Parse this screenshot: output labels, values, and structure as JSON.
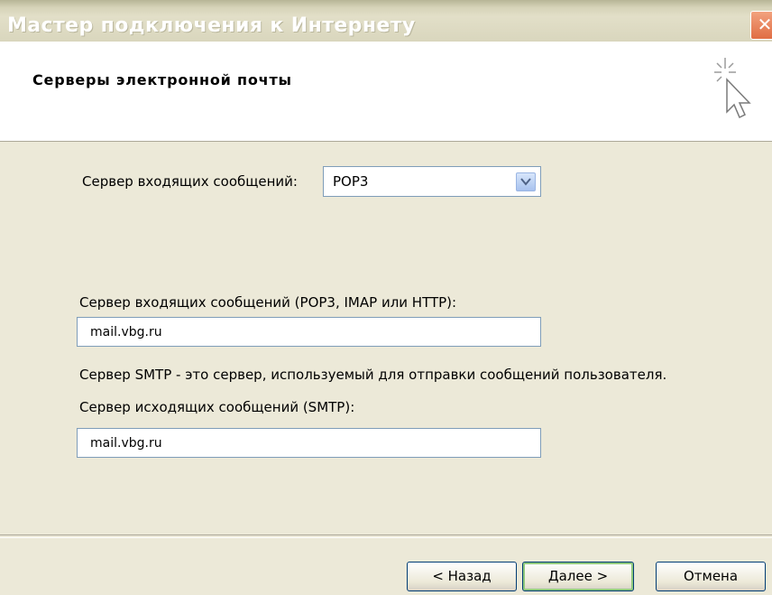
{
  "window": {
    "title": "Мастер подключения к Интернету",
    "close_glyph": "✕"
  },
  "header": {
    "title": "Серверы электронной почты",
    "icon": "wizard-cursor-icon"
  },
  "incoming_type": {
    "label": "Сервер входящих сообщений:",
    "value": "POP3"
  },
  "incoming_server": {
    "label": "Сервер входящих сообщений (POP3, IMAP или HTTP):",
    "value": "mail.vbg.ru"
  },
  "smtp_info": "Сервер SMTP - это сервер, используемый для отправки сообщений  пользователя.",
  "outgoing_server": {
    "label": "Сервер исходящих сообщений (SMTP):",
    "value": "mail.vbg.ru"
  },
  "buttons": {
    "back": "< Назад",
    "next": "Далее >",
    "cancel": "Отмена"
  },
  "colors": {
    "background": "#ECE9D8",
    "field_border": "#7f9db9",
    "button_border": "#003c74"
  }
}
